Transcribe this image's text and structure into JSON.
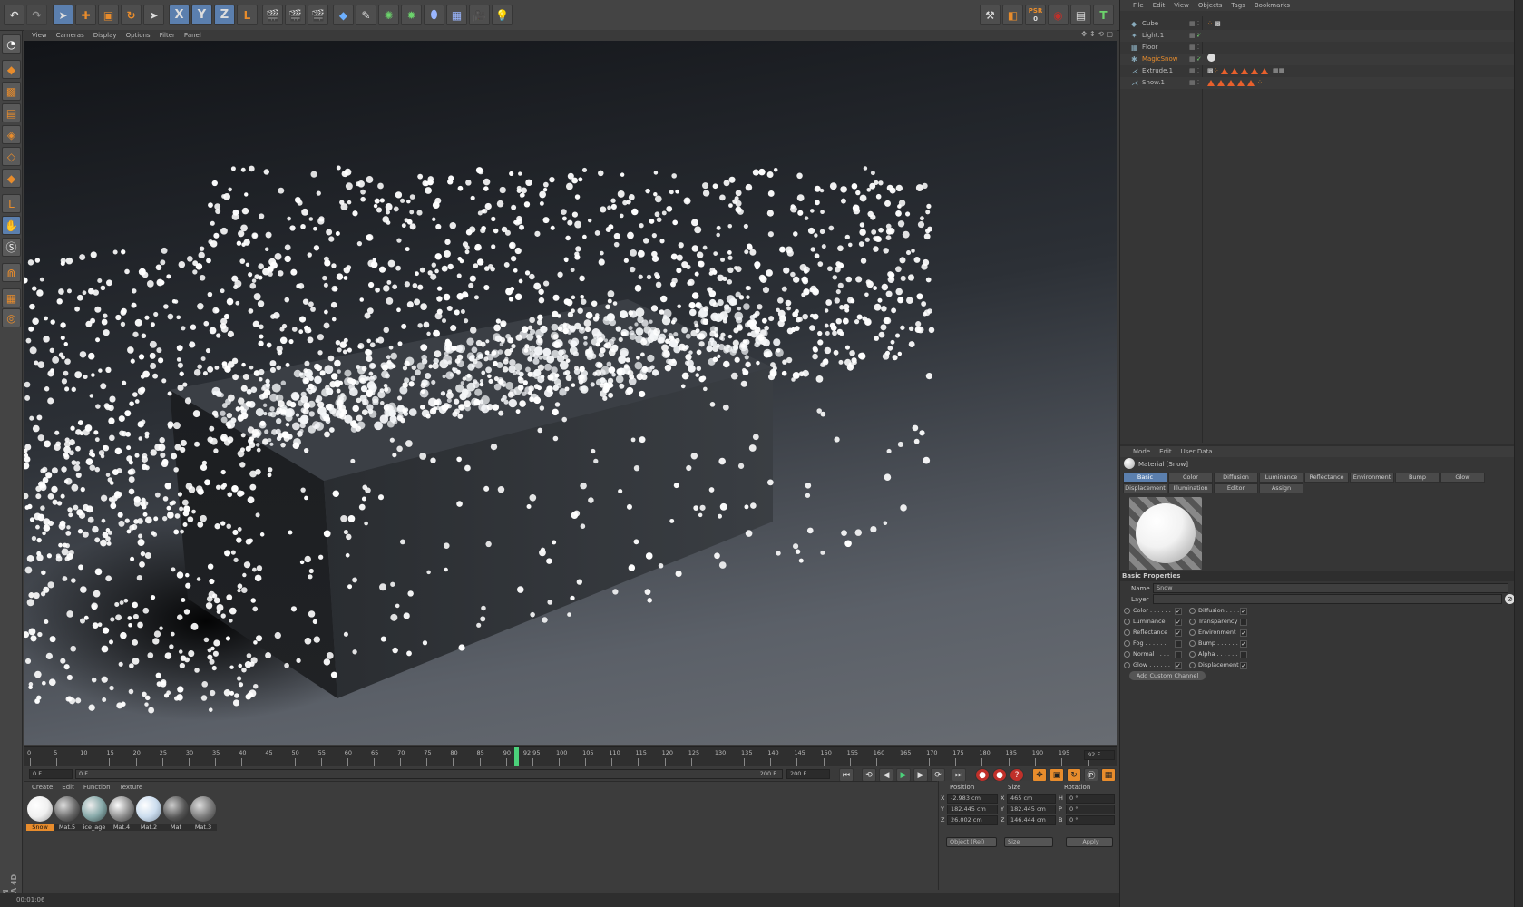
{
  "toolbar": {
    "left_tools": [
      "undo-icon",
      "redo-icon",
      "live-select-icon",
      "move-icon",
      "scale-icon",
      "rotate-icon",
      "select-icon"
    ],
    "axis": [
      "X",
      "Y",
      "Z"
    ],
    "psr_label": "PSR",
    "psr_value": "0",
    "tool_icons": [
      "render-view-icon",
      "render-picture-viewer-icon",
      "render-settings-icon",
      "cube-primitive-icon",
      "spline-pen-icon",
      "subdivision-icon",
      "array-icon",
      "deformer-icon",
      "floor-icon",
      "camera-icon",
      "light-icon"
    ],
    "right_icons": [
      "snap-icon",
      "psr-icon",
      "move-camera-icon",
      "workplane-icon",
      "t-icon"
    ]
  },
  "viewport": {
    "menu": [
      "View",
      "Cameras",
      "Display",
      "Options",
      "Filter",
      "Panel"
    ]
  },
  "timeline": {
    "ticks": [
      "0",
      "5",
      "10",
      "15",
      "20",
      "25",
      "30",
      "35",
      "40",
      "45",
      "50",
      "55",
      "60",
      "65",
      "70",
      "75",
      "80",
      "85",
      "90",
      "92 95",
      "100",
      "105",
      "110",
      "115",
      "120",
      "125",
      "130",
      "135",
      "140",
      "145",
      "150",
      "155",
      "160",
      "165",
      "170",
      "175",
      "180",
      "185",
      "190",
      "195",
      "200"
    ],
    "current_frame": "92 F",
    "start": "0 F",
    "range_start": "0 F",
    "range_end": "200 F",
    "end": "200 F",
    "playhead_frame": 92,
    "max_frame": 200
  },
  "materials": {
    "menu": [
      "Create",
      "Edit",
      "Function",
      "Texture"
    ],
    "items": [
      {
        "name": "Snow",
        "selected": true
      },
      {
        "name": "Mat.5",
        "selected": false
      },
      {
        "name": "ice_age",
        "selected": false
      },
      {
        "name": "Mat.4",
        "selected": false
      },
      {
        "name": "Mat.2",
        "selected": false
      },
      {
        "name": "Mat",
        "selected": false
      },
      {
        "name": "Mat.3",
        "selected": false
      }
    ]
  },
  "coordinates": {
    "headers": [
      "Position",
      "Size",
      "Rotation"
    ],
    "rows": [
      {
        "axis": "X",
        "pos": "-2.983 cm",
        "size_axis": "X",
        "size": "465 cm",
        "rot_axis": "H",
        "rot": "0 °"
      },
      {
        "axis": "Y",
        "pos": "182.445 cm",
        "size_axis": "Y",
        "size": "182.445 cm",
        "rot_axis": "P",
        "rot": "0 °"
      },
      {
        "axis": "Z",
        "pos": "26.002 cm",
        "size_axis": "Z",
        "size": "146.444 cm",
        "rot_axis": "B",
        "rot": "0 °"
      }
    ],
    "mode": "Object (Rel)",
    "size_mode": "Size",
    "apply": "Apply"
  },
  "status": {
    "time": "00:01:06"
  },
  "logo": {
    "brand": "MAXON",
    "product": "CINEMA 4D"
  },
  "object_manager": {
    "menu": [
      "File",
      "Edit",
      "View",
      "Objects",
      "Tags",
      "Bookmarks"
    ],
    "objects": [
      {
        "name": "Cube",
        "highlight": false
      },
      {
        "name": "Light.1",
        "highlight": false
      },
      {
        "name": "Floor",
        "highlight": false
      },
      {
        "name": "MagicSnow",
        "highlight": true
      },
      {
        "name": "Extrude.1",
        "highlight": false
      },
      {
        "name": "Snow.1",
        "highlight": false
      }
    ]
  },
  "attributes": {
    "menu": [
      "Mode",
      "Edit",
      "User Data"
    ],
    "material_title": "Material [Snow]",
    "tabs_row1": [
      {
        "label": "Basic",
        "active": true
      },
      {
        "label": "Color",
        "active": false
      },
      {
        "label": "Diffusion",
        "active": false
      },
      {
        "label": "Luminance",
        "active": false
      },
      {
        "label": "Reflectance",
        "active": false
      },
      {
        "label": "Environment",
        "active": false
      },
      {
        "label": "Bump",
        "active": false
      },
      {
        "label": "Glow",
        "active": false
      }
    ],
    "tabs_row2": [
      "Displacement",
      "Illumination",
      "Editor",
      "Assign"
    ],
    "section": "Basic Properties",
    "name_label": "Name",
    "name_value": "Snow",
    "layer_label": "Layer",
    "channels_left": [
      {
        "label": "Color . . . . . .",
        "checked": true
      },
      {
        "label": "Luminance",
        "checked": true
      },
      {
        "label": "Reflectance",
        "checked": true
      },
      {
        "label": "Fog . . . . . .",
        "checked": false
      },
      {
        "label": "Normal . . . .",
        "checked": false
      },
      {
        "label": "Glow . . . . . .",
        "checked": true
      }
    ],
    "channels_right": [
      {
        "label": "Diffusion . . . .",
        "checked": true
      },
      {
        "label": "Transparency",
        "checked": false
      },
      {
        "label": "Environment",
        "checked": true
      },
      {
        "label": "Bump . . . . . .",
        "checked": true
      },
      {
        "label": "Alpha . . . . . .",
        "checked": false
      },
      {
        "label": "Displacement",
        "checked": true
      }
    ],
    "add_channel": "Add Custom Channel"
  },
  "colors": {
    "accent": "#e88c2c",
    "selected": "#5b7fae",
    "snow": "#ffffff"
  }
}
